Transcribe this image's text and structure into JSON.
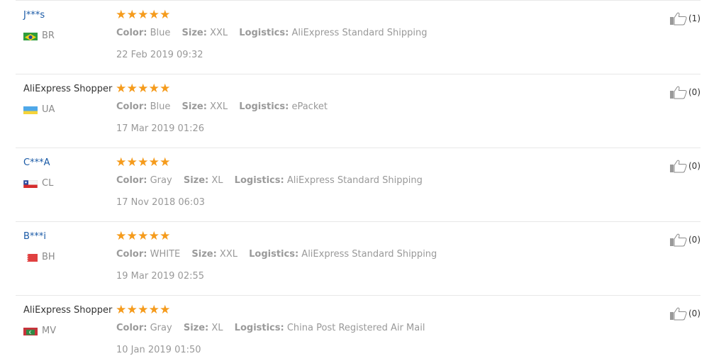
{
  "labels": {
    "color": "Color:",
    "size": "Size:",
    "logistics": "Logistics:"
  },
  "reviews": [
    {
      "buyer": "J***s",
      "country": "BR",
      "flag": "brazil-flag-icon",
      "rating": 5,
      "color": "Blue",
      "size": "XXL",
      "logistics": "AliExpress Standard Shipping",
      "date": "22 Feb 2019 09:32",
      "helpful": "(1)"
    },
    {
      "buyer": "AliExpress Shopper",
      "country": "UA",
      "flag": "ukraine-flag-icon",
      "rating": 5,
      "color": "Blue",
      "size": "XXL",
      "logistics": "ePacket",
      "date": "17 Mar 2019 01:26",
      "helpful": "(0)"
    },
    {
      "buyer": "C***A",
      "country": "CL",
      "flag": "chile-flag-icon",
      "rating": 5,
      "color": "Gray",
      "size": "XL",
      "logistics": "AliExpress Standard Shipping",
      "date": "17 Nov 2018 06:03",
      "helpful": "(0)"
    },
    {
      "buyer": "B***i",
      "country": "BH",
      "flag": "bahrain-flag-icon",
      "rating": 5,
      "color": "WHITE",
      "size": "XXL",
      "logistics": "AliExpress Standard Shipping",
      "date": "19 Mar 2019 02:55",
      "helpful": "(0)"
    },
    {
      "buyer": "AliExpress Shopper",
      "country": "MV",
      "flag": "maldives-flag-icon",
      "rating": 5,
      "color": "Gray",
      "size": "XL",
      "logistics": "China Post Registered Air Mail",
      "date": "10 Jan 2019 01:50",
      "helpful": "(0)"
    }
  ],
  "colors": {
    "star": "#f59b1c",
    "masked_name": "#1a5aa6",
    "meta_text": "#999999",
    "separator": "#e8e8e8"
  }
}
